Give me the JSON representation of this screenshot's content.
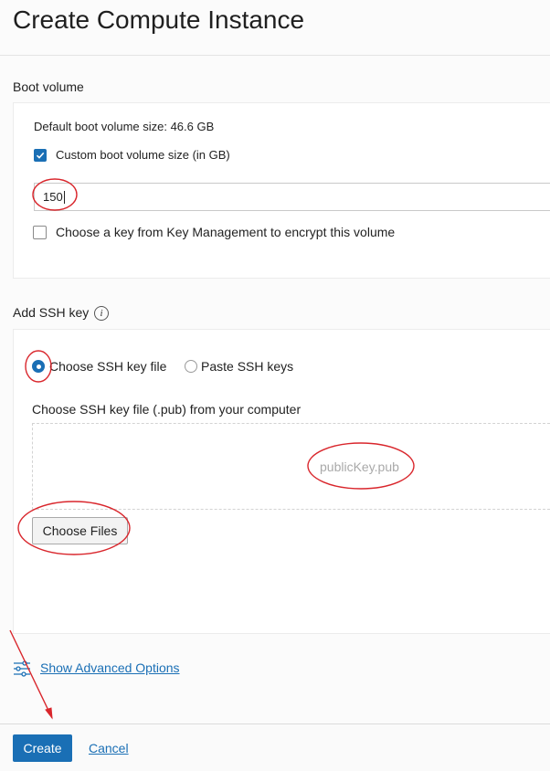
{
  "page": {
    "title": "Create Compute Instance"
  },
  "boot_volume": {
    "section_label": "Boot volume",
    "default_size_text": "Default boot volume size: 46.6 GB",
    "custom_size_label": "Custom boot volume size (in GB)",
    "custom_size_checked": true,
    "size_value": "150",
    "key_mgmt_label": "Choose a key from Key Management to encrypt this volume",
    "key_mgmt_checked": false
  },
  "ssh": {
    "section_label": "Add SSH key",
    "info_icon": "info-icon",
    "option_file_label": "Choose SSH key file",
    "option_paste_label": "Paste SSH keys",
    "selected_option": "Choose SSH key file",
    "file_prompt": "Choose SSH key file (.pub) from your computer",
    "file_name": "publicKey.pub",
    "choose_files_label": "Choose Files"
  },
  "advanced": {
    "label": "Show Advanced Options",
    "icon": "sliders-icon"
  },
  "footer": {
    "create_label": "Create",
    "cancel_label": "Cancel"
  },
  "colors": {
    "accent": "#1a6fb5",
    "annotation": "#d9262c"
  }
}
